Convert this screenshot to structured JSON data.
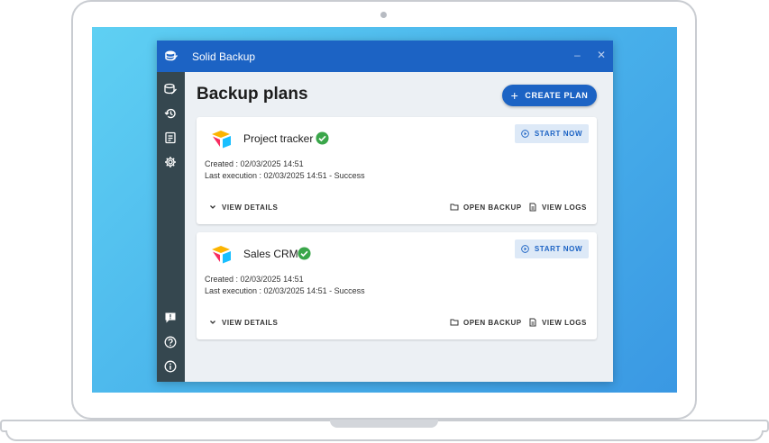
{
  "window": {
    "title": "Solid Backup",
    "minimize_glyph": "–",
    "close_glyph": "✕"
  },
  "sidebar": {
    "items": [
      {
        "name": "backups-icon"
      },
      {
        "name": "history-icon"
      },
      {
        "name": "logs-icon"
      },
      {
        "name": "settings-icon"
      },
      {
        "name": "feedback-icon"
      },
      {
        "name": "help-icon"
      },
      {
        "name": "info-icon"
      }
    ]
  },
  "main": {
    "title": "Backup plans",
    "create_label": "CREATE PLAN",
    "plans": [
      {
        "name": "Project tracker",
        "created": "Created : 02/03/2025 14:51",
        "last_execution": "Last execution : 02/03/2025 14:51 - Success",
        "start_label": "START NOW",
        "details_label": "VIEW DETAILS",
        "open_label": "OPEN BACKUP",
        "logs_label": "VIEW LOGS"
      },
      {
        "name": "Sales CRM",
        "created": "Created : 02/03/2025 14:51",
        "last_execution": "Last execution : 02/03/2025 14:51 - Success",
        "start_label": "START NOW",
        "details_label": "VIEW DETAILS",
        "open_label": "OPEN BACKUP",
        "logs_label": "VIEW LOGS"
      }
    ]
  },
  "colors": {
    "primary": "#1c63c4",
    "sidebar": "#35474f",
    "success": "#3aa64a",
    "background": "#ecf0f4"
  }
}
